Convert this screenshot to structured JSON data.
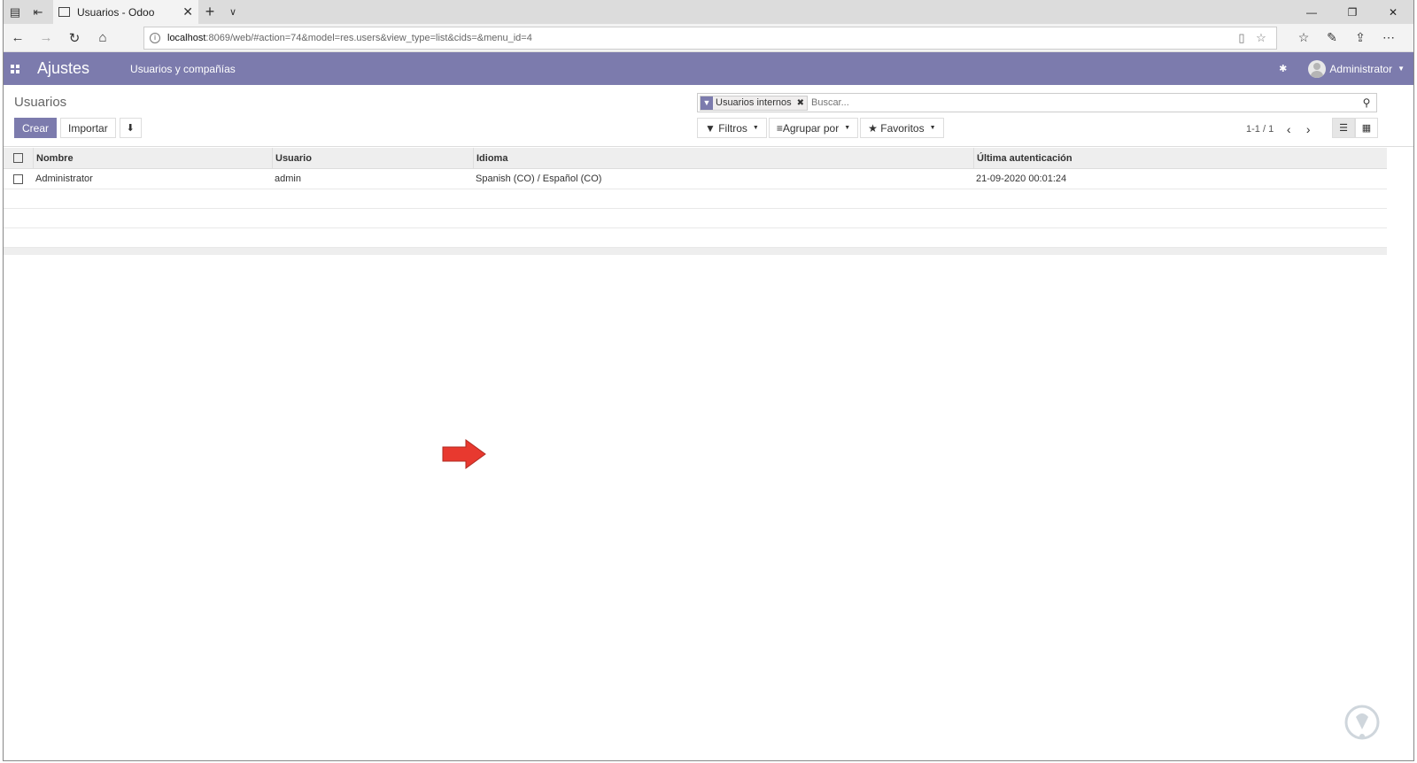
{
  "browser": {
    "tab_title": "Usuarios - Odoo",
    "url_host": "localhost",
    "url_path": ":8069/web/#action=74&model=res.users&view_type=list&cids=&menu_id=4"
  },
  "navbar": {
    "brand": "Ajustes",
    "menu_item": "Usuarios y compañías",
    "user_name": "Administrator",
    "color": "#7c7bad"
  },
  "control_panel": {
    "breadcrumb": "Usuarios",
    "create_label": "Crear",
    "import_label": "Importar",
    "facet_label": "Usuarios internos",
    "search_placeholder": "Buscar...",
    "filters_label": "Filtros",
    "groupby_label": "Agrupar por",
    "favorites_label": "Favoritos",
    "pager": "1-1 / 1"
  },
  "table": {
    "columns": [
      "Nombre",
      "Usuario",
      "Idioma",
      "Última autenticación"
    ],
    "rows": [
      [
        "Administrator",
        "admin",
        "Spanish (CO) / Español (CO)",
        "21-09-2020 00:01:24"
      ]
    ]
  },
  "icons": {
    "apps": "apps-grid-icon",
    "bug": "bug-icon",
    "download": "download-icon",
    "filter": "filter-icon",
    "search": "search-icon",
    "list_view": "list-view-icon",
    "kanban_view": "kanban-view-icon"
  }
}
